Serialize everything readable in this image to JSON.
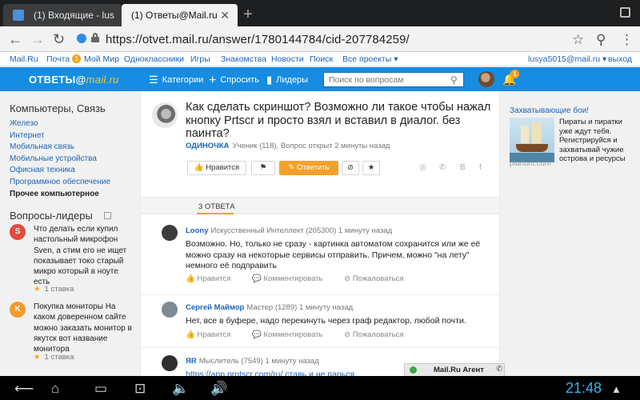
{
  "browser": {
    "tabs": [
      {
        "title": "(1) Входящие - lus"
      },
      {
        "title": "(1) Ответы@Mail.ru"
      }
    ],
    "url": "https://otvet.mail.ru/answer/1780144784/cid-207784259/"
  },
  "portal": {
    "links": [
      "Mail.Ru",
      "Почта",
      "Мой Мир",
      "Одноклассники",
      "Игры",
      "Знакомства",
      "Новости",
      "Поиск",
      "Все проекты ▾"
    ],
    "mail_badge": "1",
    "user": "lusya5015@mail.ru ▾",
    "logout": "выход"
  },
  "header": {
    "logo_text": "ОТВЕТЫ@",
    "logo_suffix": "mail.ru",
    "nav": [
      "Категории",
      "Спросить",
      "Лидеры"
    ],
    "search_placeholder": "Поиск по вопросам",
    "notif_count": "1"
  },
  "sidebar": {
    "category_title": "Компьютеры, Связь",
    "categories": [
      "Железо",
      "Интернет",
      "Мобильная связь",
      "Мобильные устройства",
      "Офисная техника",
      "Программное обеспечение",
      "Прочее компьютерное"
    ],
    "leaders_title": "Вопросы-лидеры",
    "leaders": [
      {
        "letter": "S",
        "color": "#e34b3e",
        "text": "Что делать если купил настольный микрофон Sven, а стим его не ищет показывает токо старый микро который в ноуте есть",
        "stake": "1 ставка"
      },
      {
        "letter": "K",
        "color": "#f49a2e",
        "text": "Покупка мониторы На каком доверенном сайте можно заказать монитор в якутск вот название монитора",
        "stake": "1 ставка"
      }
    ]
  },
  "question": {
    "title": "Как сделать скриншот? Возможно ли такое чтобы нажал кнопку Prtscr и просто взял и вставил в диалог. без паинта?",
    "author": "ОДИНОЧКА",
    "meta": "Ученик (118), Вопрос открыт 2 минуты назад",
    "like_label": "Нравится",
    "answer_label": "Ответить",
    "answers_tab": "3 ОТВЕТА"
  },
  "answers": [
    {
      "name": "Loony",
      "rank": "Искусственный Интеллект (205300)",
      "time": "1 минуту назад",
      "text": "Возможно. Но, только не сразу - картинка автоматом сохранится или же её можно сразу на некоторые сервисы отправить. Причем, можно \"на лету\" немного её подправить",
      "avatar_color": "#3b3b3b"
    },
    {
      "name": "Сергей Маймор",
      "rank": "Мастер (1289)",
      "time": "1 минуту назад",
      "text": "Нет, все в буфере, надо перекинуть через граф редактор, любой почти.",
      "avatar_color": "#7d8a96"
    },
    {
      "name": "ЯR",
      "rank": "Мыслитель (7549)",
      "time": "1 минуту назад",
      "text": "https://app.prntscr.com/ru/ ставь и не парься",
      "avatar_color": "#2f2f2f"
    }
  ],
  "answer_actions": {
    "like": "Нравится",
    "comment": "Комментировать",
    "report": "Пожаловаться"
  },
  "ad": {
    "title": "Захватывающие бои!",
    "text": "Пираты и пиратки уже ждут тебя. Регистрируйся и захватывай чужие острова и ресурсы",
    "source": "plarium.com"
  },
  "agent": {
    "label": "Mail.Ru Агент"
  },
  "system": {
    "clock": "21:48"
  }
}
